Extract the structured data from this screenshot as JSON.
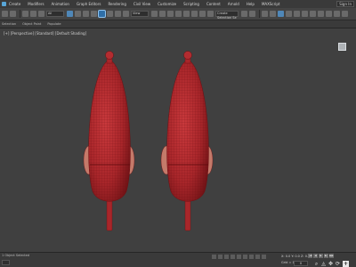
{
  "menubar": {
    "items": [
      "Create",
      "Modifiers",
      "Animation",
      "Graph Editors",
      "Rendering",
      "Civil View",
      "Customize",
      "Scripting",
      "Content",
      "Arnold",
      "Help",
      "MAXScript"
    ],
    "sign_in": "Sign In"
  },
  "toolbar": {
    "filter_dropdown": "All",
    "view_dropdown": "View",
    "selection_set": "Create Selection Se"
  },
  "ribbon": {
    "items": [
      "Selection",
      "Object Paint",
      "Populate"
    ]
  },
  "viewport": {
    "label": "[+] [Perspective] [Standard] [Default Shading]",
    "background_color": "#404040",
    "object_color": "#a8262a",
    "wire_color": "#6e0f12"
  },
  "statusbar": {
    "left_text": "1 Object Selected",
    "coords": "X: 0.0  Y: 0.0  Z: 0.0",
    "grid": "Grid = 10.0mm",
    "frame": "0",
    "auto_key_label": "Auto Key",
    "set_key_label": "Set Key"
  }
}
